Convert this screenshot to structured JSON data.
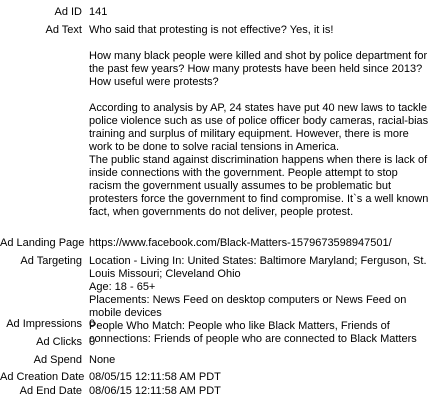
{
  "fields": {
    "ad_id": {
      "label": "Ad ID",
      "value": "141"
    },
    "ad_text": {
      "label": "Ad Text",
      "paragraphs": [
        "Who said that protesting is not effective? Yes, it is!",
        "How many black people were killed and shot by police department for the past few years? How many protests have been held since 2013? How useful were protests?",
        "According to analysis by AP, 24 states have put 40 new laws to tackle police violence such as use of police officer body cameras, racial-bias training and surplus of military equipment. However, there is more work to be done to solve racial tensions in America.",
        "The public stand against discrimination happens when there is lack of inside connections with the government. People attempt to stop racism the government usually assumes to be problematic but protesters force the government to find compromise. It`s a well known fact, when governments do not deliver, people protest."
      ]
    },
    "ad_landing_page": {
      "label": "Ad Landing Page",
      "value": "https://www.facebook.com/Black-Matters-1579673598947501/"
    },
    "ad_targeting": {
      "label": "Ad Targeting",
      "location": "Location - Living In: United States: Baltimore Maryland; Ferguson, St. Louis Missouri; Cleveland Ohio",
      "age": "Age: 18 - 65+",
      "placements": "Placements: News Feed on desktop computers or News Feed on mobile devices",
      "people": "People Who Match: People who like Black Matters, Friends of connections: Friends of people who are connected to Black Matters"
    },
    "ad_impressions": {
      "label": "Ad Impressions",
      "value": "0"
    },
    "ad_clicks": {
      "label": "Ad Clicks",
      "value": "0"
    },
    "ad_spend": {
      "label": "Ad Spend",
      "value": "None"
    },
    "ad_creation_date": {
      "label": "Ad Creation Date",
      "value": "08/05/15 12:11:58 AM PDT"
    },
    "ad_end_date": {
      "label": "Ad End Date",
      "value": "08/06/15 12:11:58 AM PDT"
    }
  }
}
